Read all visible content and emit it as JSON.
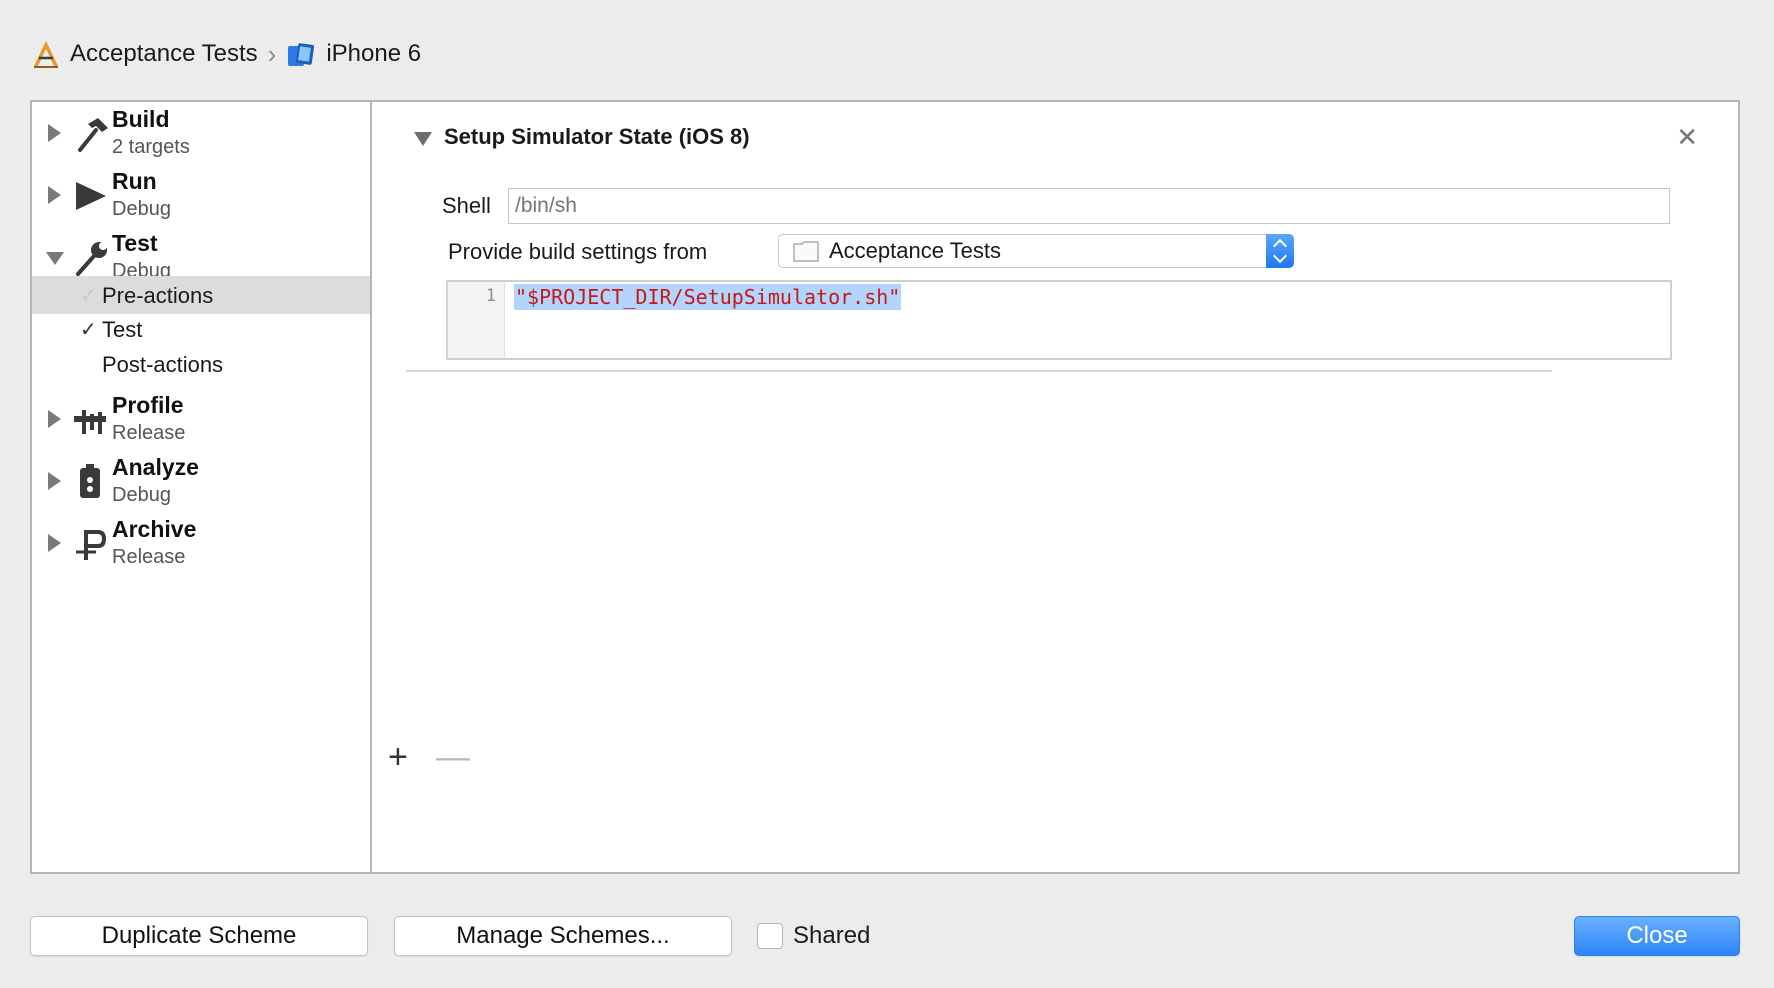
{
  "breadcrumb": {
    "project": "Acceptance Tests",
    "device": "iPhone 6"
  },
  "sidebar": {
    "actions": [
      {
        "title": "Build",
        "subtitle": "2 targets",
        "icon": "hammer-icon"
      },
      {
        "title": "Run",
        "subtitle": "Debug",
        "icon": "play-icon"
      },
      {
        "title": "Test",
        "subtitle": "Debug",
        "icon": "wrench-icon"
      },
      {
        "title": "Profile",
        "subtitle": "Release",
        "icon": "instruments-icon"
      },
      {
        "title": "Analyze",
        "subtitle": "Debug",
        "icon": "analyze-icon"
      },
      {
        "title": "Archive",
        "subtitle": "Release",
        "icon": "archive-icon"
      }
    ],
    "test_subitems": [
      {
        "label": "Pre-actions",
        "check": "✓",
        "selected": true
      },
      {
        "label": "Test",
        "check": "✓",
        "selected": false
      },
      {
        "label": "Post-actions",
        "check": "",
        "selected": false
      }
    ]
  },
  "content": {
    "section_title": "Setup Simulator State (iOS 8)",
    "close_glyph": "✕",
    "shell_label": "Shell",
    "shell_placeholder": "/bin/sh",
    "provide_label": "Provide build settings from",
    "build_settings_value": "Acceptance Tests",
    "line_number": "1",
    "script": "\"$PROJECT_DIR/SetupSimulator.sh\"",
    "add_glyph": "+",
    "remove_glyph": "—"
  },
  "footer": {
    "duplicate_label": "Duplicate Scheme",
    "manage_label": "Manage Schemes...",
    "shared_label": "Shared",
    "close_label": "Close"
  },
  "colors": {
    "accent": "#2c84f5",
    "selection": "#dcdcdc",
    "code_string": "#c41a16",
    "code_highlight": "#b3d4fd"
  }
}
